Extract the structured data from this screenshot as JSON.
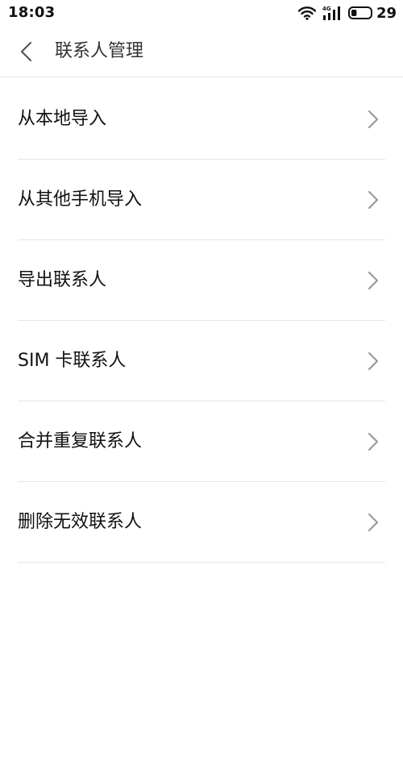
{
  "status_bar": {
    "time": "18:03",
    "network_type": "4G",
    "battery_level": "29",
    "icons": [
      "wifi-icon",
      "signal-icon",
      "battery-icon"
    ]
  },
  "header": {
    "back_icon": "chevron-left-icon",
    "title": "联系人管理"
  },
  "menu": {
    "items": [
      {
        "label": "从本地导入",
        "icon": "chevron-right-icon"
      },
      {
        "label": "从其他手机导入",
        "icon": "chevron-right-icon"
      },
      {
        "label": "导出联系人",
        "icon": "chevron-right-icon"
      },
      {
        "label": "SIM 卡联系人",
        "icon": "chevron-right-icon"
      },
      {
        "label": "合并重复联系人",
        "icon": "chevron-right-icon"
      },
      {
        "label": "删除无效联系人",
        "icon": "chevron-right-icon"
      }
    ]
  },
  "colors": {
    "background": "#ffffff",
    "text": "#111111",
    "title_text": "#333333",
    "divider": "#e6e6e6",
    "chevron": "#9a9a9a"
  }
}
